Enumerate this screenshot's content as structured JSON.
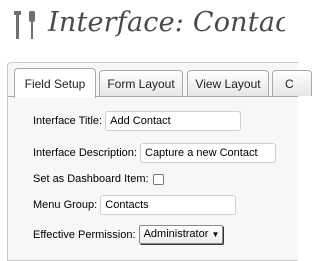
{
  "header": {
    "icon": "tools-icon",
    "title": "Interface: Contacts M"
  },
  "tabs": [
    {
      "label": "Field Setup",
      "active": true
    },
    {
      "label": "Form Layout",
      "active": false
    },
    {
      "label": "View Layout",
      "active": false
    },
    {
      "label": "C",
      "active": false
    }
  ],
  "form": {
    "interface_title": {
      "label": "Interface Title:",
      "value": "Add Contact"
    },
    "interface_description": {
      "label": "Interface Description:",
      "value": "Capture a new Contact"
    },
    "dashboard_item": {
      "label": "Set as Dashboard Item:",
      "checked": false
    },
    "menu_group": {
      "label": "Menu Group:",
      "value": "Contacts"
    },
    "effective_permission": {
      "label": "Effective Permission:",
      "value": "Administrator",
      "arrow": "▼"
    }
  }
}
